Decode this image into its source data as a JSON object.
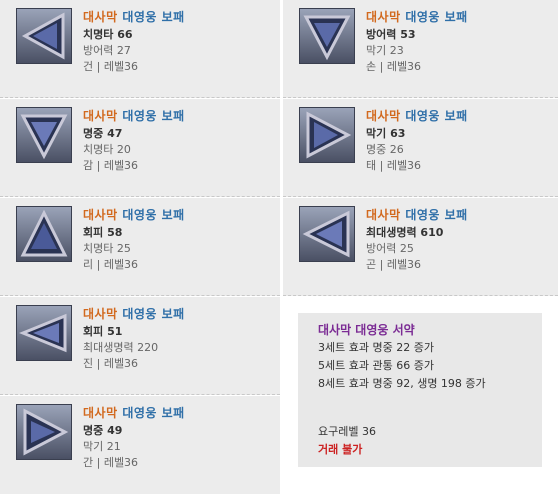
{
  "items": [
    {
      "name_part1": "대사막",
      "name_part2": "대영웅 보패",
      "stat1": "치명타 66",
      "stat2": "방어력 27",
      "meta": "건 | 레벨36"
    },
    {
      "name_part1": "대사막",
      "name_part2": "대영웅 보패",
      "stat1": "방어력 53",
      "stat2": "막기 23",
      "meta": "손 | 레벨36"
    },
    {
      "name_part1": "대사막",
      "name_part2": "대영웅 보패",
      "stat1": "명중 47",
      "stat2": "치명타 20",
      "meta": "감 | 레벨36"
    },
    {
      "name_part1": "대사막",
      "name_part2": "대영웅 보패",
      "stat1": "막기 63",
      "stat2": "명중 26",
      "meta": "태 | 레벨36"
    },
    {
      "name_part1": "대사막",
      "name_part2": "대영웅 보패",
      "stat1": "회피 58",
      "stat2": "치명타 25",
      "meta": "리 | 레벨36"
    },
    {
      "name_part1": "대사막",
      "name_part2": "대영웅 보패",
      "stat1": "최대생명력 610",
      "stat2": "방어력 25",
      "meta": "곤 | 레벨36"
    },
    {
      "name_part1": "대사막",
      "name_part2": "대영웅 보패",
      "stat1": "회피 51",
      "stat2": "최대생명력 220",
      "meta": "진 | 레벨36"
    },
    {
      "name_part1": "대사막",
      "name_part2": "대영웅 보패",
      "stat1": "명중 49",
      "stat2": "막기 21",
      "meta": "간 | 레벨36"
    }
  ],
  "set": {
    "title": "대사막 대영웅 서약",
    "effects": [
      "3세트 효과 명중 22 증가",
      "5세트 효과 관통 66 증가",
      "8세트 효과 명중 92, 생명 198 증가"
    ],
    "required_level": "요구레벨 36",
    "trade": "거래 불가"
  },
  "colors": {
    "name_part1": "#d2691e",
    "name_part2": "#2f6fa8",
    "set_title": "#7b2b94",
    "trade": "#cc2222"
  }
}
